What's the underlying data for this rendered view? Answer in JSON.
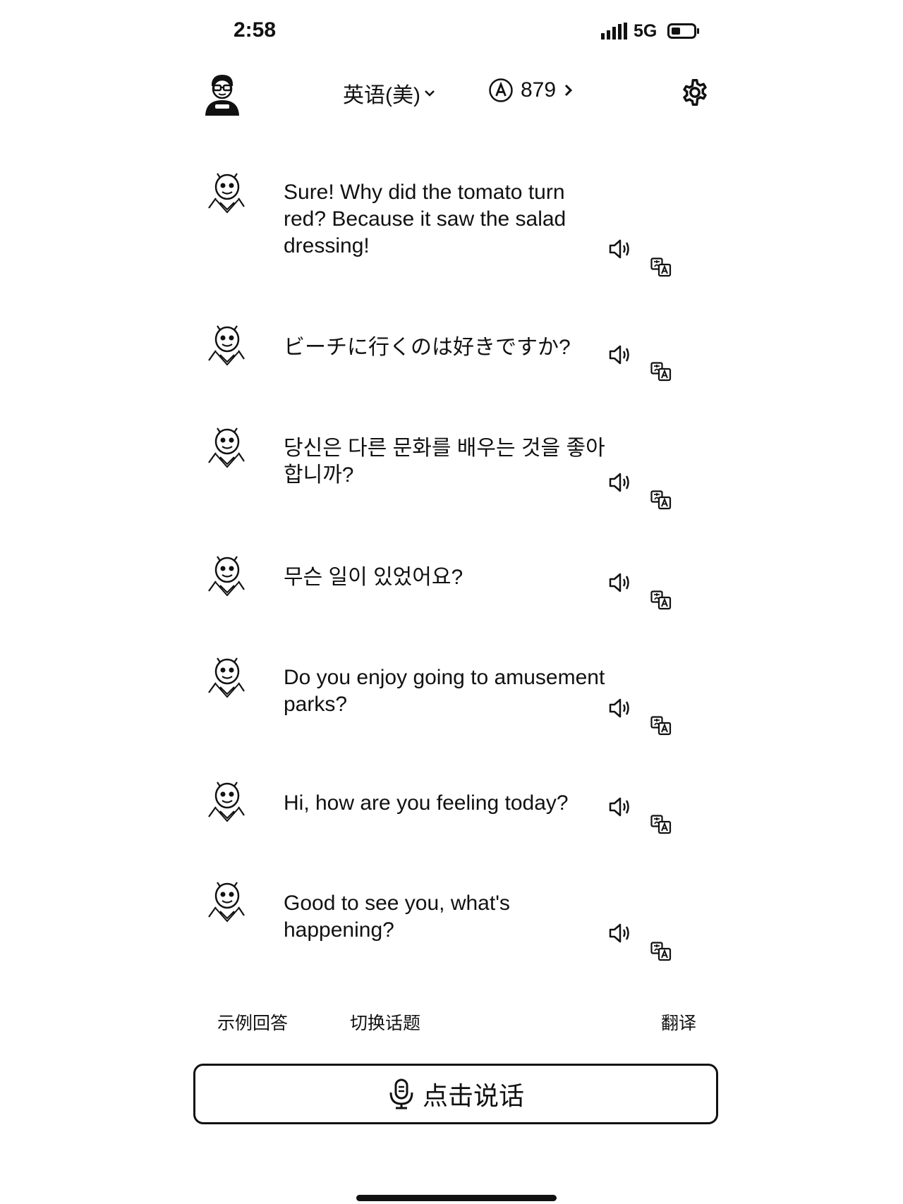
{
  "status_bar": {
    "time": "2:58",
    "network": "5G"
  },
  "header": {
    "language": "英语(美)",
    "points": "879"
  },
  "messages": [
    {
      "text": "Sure! Why did the tomato turn red? Because it saw the salad dressing!"
    },
    {
      "text": "ビーチに行くのは好きですか?"
    },
    {
      "text": "당신은 다른 문화를 배우는 것을 좋아합니까?"
    },
    {
      "text": "무슨 일이 있었어요?"
    },
    {
      "text": "Do you enjoy going to amusement parks?"
    },
    {
      "text": "Hi, how are you feeling today?"
    },
    {
      "text": "Good to see you, what's happening?"
    }
  ],
  "actions": {
    "example_answer": "示例回答",
    "switch_topic": "切换话题",
    "translate": "翻译",
    "talk_button": "点击说话"
  },
  "icons": {
    "user_avatar": "user-avatar",
    "bot_avatar": "bot-avatar",
    "speaker": "speaker-icon",
    "translate": "translate-icon",
    "settings": "gear-icon",
    "points": "a-coin-icon",
    "mic": "mic-icon"
  },
  "colors": {
    "text": "#111111",
    "background": "#ffffff"
  }
}
